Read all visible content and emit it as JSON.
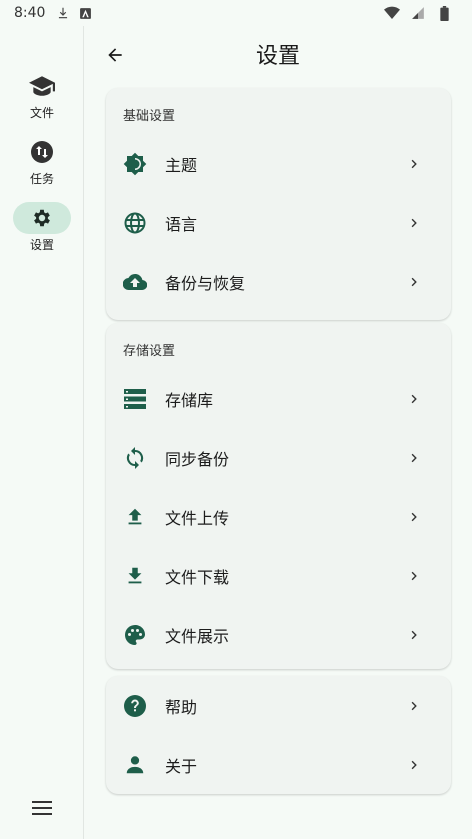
{
  "status_bar": {
    "time": "8:40"
  },
  "nav_rail": {
    "items": [
      {
        "label": "文件",
        "icon": "school-icon"
      },
      {
        "label": "任务",
        "icon": "swap-icon"
      },
      {
        "label": "设置",
        "icon": "gear-icon",
        "active": true
      }
    ]
  },
  "header": {
    "title": "设置"
  },
  "sections": [
    {
      "title": "基础设置",
      "items": [
        {
          "label": "主题",
          "icon": "brightness-icon"
        },
        {
          "label": "语言",
          "icon": "globe-icon"
        },
        {
          "label": "备份与恢复",
          "icon": "cloud-upload-icon"
        }
      ]
    },
    {
      "title": "存储设置",
      "items": [
        {
          "label": "存储库",
          "icon": "storage-icon"
        },
        {
          "label": "同步备份",
          "icon": "sync-icon"
        },
        {
          "label": "文件上传",
          "icon": "upload-icon"
        },
        {
          "label": "文件下载",
          "icon": "download-icon"
        },
        {
          "label": "文件展示",
          "icon": "palette-icon"
        }
      ]
    },
    {
      "title": "",
      "items": [
        {
          "label": "帮助",
          "icon": "help-icon"
        },
        {
          "label": "关于",
          "icon": "person-icon"
        }
      ]
    }
  ],
  "colors": {
    "accent": "#1e5e4a",
    "active_pill": "#cfe9dc",
    "card_bg": "#f0f4f1",
    "background": "#f5faf6"
  }
}
